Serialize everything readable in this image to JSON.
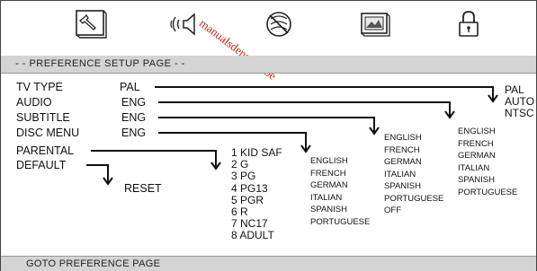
{
  "watermark": "manualsdenstore.be",
  "icons": [
    "general-setup-icon",
    "audio-setup-icon",
    "dolby-digital-setup-icon",
    "video-setup-icon",
    "preference-lock-icon"
  ],
  "page_title": "- -  PREFERENCE SETUP PAGE  - -",
  "footer": "GOTO PREFERENCE PAGE",
  "menu": {
    "tv_type": {
      "label": "TV TYPE",
      "value": "PAL",
      "options": [
        "PAL",
        "AUTO",
        "NTSC"
      ]
    },
    "audio": {
      "label": "AUDIO",
      "value": "ENG",
      "options": [
        "ENGLISH",
        "FRENCH",
        "GERMAN",
        "ITALIAN",
        "SPANISH",
        "PORTUGUESE"
      ]
    },
    "subtitle": {
      "label": "SUBTITLE",
      "value": "ENG",
      "options": [
        "ENGLISH",
        "FRENCH",
        "GERMAN",
        "ITALIAN",
        "SPANISH",
        "PORTUGUESE",
        "OFF"
      ]
    },
    "disc_menu": {
      "label": "DISC MENU",
      "value": "ENG",
      "options": [
        "ENGLISH",
        "FRENCH",
        "GERMAN",
        "ITALIAN",
        "SPANISH",
        "PORTUGUESE"
      ]
    },
    "parental": {
      "label": "PARENTAL",
      "options": [
        "1 KID SAF",
        "2 G",
        "3 PG",
        "4 PG13",
        "5 PGR",
        "6 R",
        "7 NC17",
        "8 ADULT"
      ]
    },
    "default": {
      "label": "DEFAULT",
      "options": [
        "RESET"
      ]
    }
  }
}
